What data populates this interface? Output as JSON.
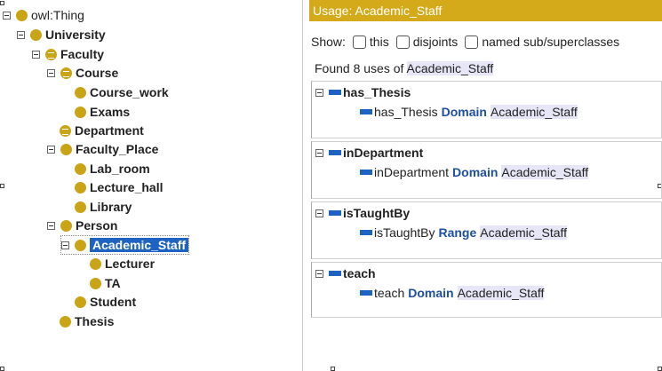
{
  "tree": [
    {
      "label": "owl:Thing",
      "bold": false,
      "defined": false
    },
    {
      "label": "University",
      "bold": true,
      "defined": false
    },
    {
      "label": "Faculty",
      "bold": true,
      "defined": true
    },
    {
      "label": "Course",
      "bold": true,
      "defined": true
    },
    {
      "label": "Course_work",
      "bold": true,
      "defined": false
    },
    {
      "label": "Exams",
      "bold": true,
      "defined": false
    },
    {
      "label": "Department",
      "bold": true,
      "defined": true
    },
    {
      "label": "Faculty_Place",
      "bold": true,
      "defined": false
    },
    {
      "label": "Lab_room",
      "bold": true,
      "defined": false
    },
    {
      "label": "Lecture_hall",
      "bold": true,
      "defined": false
    },
    {
      "label": "Library",
      "bold": true,
      "defined": false
    },
    {
      "label": "Person",
      "bold": true,
      "defined": false
    },
    {
      "label": "Academic_Staff",
      "bold": true,
      "defined": false
    },
    {
      "label": "Lecturer",
      "bold": true,
      "defined": false
    },
    {
      "label": "TA",
      "bold": true,
      "defined": false
    },
    {
      "label": "Student",
      "bold": true,
      "defined": false
    },
    {
      "label": "Thesis",
      "bold": true,
      "defined": false
    }
  ],
  "usage": {
    "title": "Usage: Academic_Staff",
    "show_label": "Show:",
    "options": [
      "this",
      "disjoints",
      "named sub/superclasses"
    ],
    "found_prefix": "Found 8 uses of",
    "found_target": "Academic_Staff",
    "groups": [
      {
        "name": "has_Thesis",
        "axiom_prop": "has_Thesis",
        "axiom_kw": "Domain",
        "axiom_target": "Academic_Staff"
      },
      {
        "name": "inDepartment",
        "axiom_prop": "inDepartment",
        "axiom_kw": "Domain",
        "axiom_target": "Academic_Staff"
      },
      {
        "name": "isTaughtBy",
        "axiom_prop": "isTaughtBy",
        "axiom_kw": "Range",
        "axiom_target": "Academic_Staff"
      },
      {
        "name": "teach",
        "axiom_prop": "teach",
        "axiom_kw": "Domain",
        "axiom_target": "Academic_Staff"
      }
    ]
  },
  "colors": {
    "class_icon": "#c9a417",
    "header_bar": "#d4a91a",
    "selection": "#1f63c2",
    "property_icon": "#1f63c2"
  }
}
